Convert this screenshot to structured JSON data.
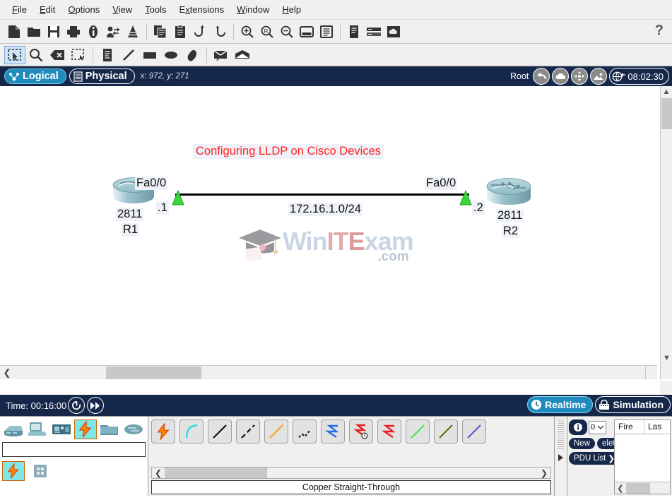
{
  "menubar": {
    "items": [
      {
        "label": "File",
        "accel": "F"
      },
      {
        "label": "Edit",
        "accel": "E"
      },
      {
        "label": "Options",
        "accel": "O"
      },
      {
        "label": "View",
        "accel": "V"
      },
      {
        "label": "Tools",
        "accel": "T"
      },
      {
        "label": "Extensions",
        "accel": "x"
      },
      {
        "label": "Window",
        "accel": "W"
      },
      {
        "label": "Help",
        "accel": "H"
      }
    ]
  },
  "toolbar": {
    "help_label": "?",
    "items": [
      {
        "name": "new-file-icon",
        "title": "New"
      },
      {
        "name": "open-folder-icon",
        "title": "Open"
      },
      {
        "name": "save-icon",
        "title": "Save"
      },
      {
        "name": "print-icon",
        "title": "Print"
      },
      {
        "name": "activity-wizard-icon",
        "title": "Activity Wizard"
      },
      {
        "name": "network-info-icon",
        "title": "Network Information"
      },
      {
        "name": "custom-devices-icon",
        "title": "Custom Devices"
      },
      {
        "name": "copy-icon",
        "title": "Copy"
      },
      {
        "name": "paste-icon",
        "title": "Paste"
      },
      {
        "name": "undo-icon",
        "title": "Undo"
      },
      {
        "name": "redo-icon",
        "title": "Redo"
      },
      {
        "name": "zoom-in-icon",
        "title": "Zoom In"
      },
      {
        "name": "zoom-reset-icon",
        "title": "Zoom Reset"
      },
      {
        "name": "zoom-out-icon",
        "title": "Zoom Out"
      },
      {
        "name": "palette-icon",
        "title": "Drawing Palette"
      },
      {
        "name": "custom-devices-dialog-icon",
        "title": "Custom Devices Dialog"
      },
      {
        "name": "viewport-icon",
        "title": "Viewport"
      },
      {
        "name": "device-rack-icon",
        "title": "Device Rack"
      },
      {
        "name": "cloud-registration-icon",
        "title": "Cloud"
      }
    ]
  },
  "toolbar2": {
    "items": [
      {
        "name": "select-tool-icon",
        "title": "Select",
        "selected": true
      },
      {
        "name": "inspect-tool-icon",
        "title": "Inspect"
      },
      {
        "name": "delete-tool-icon",
        "title": "Delete"
      },
      {
        "name": "resize-shape-tool-icon",
        "title": "Resize Shape"
      },
      {
        "name": "place-note-tool-icon",
        "title": "Place Note"
      },
      {
        "name": "draw-line-tool-icon",
        "title": "Draw Line"
      },
      {
        "name": "draw-rectangle-tool-icon",
        "title": "Draw Rectangle"
      },
      {
        "name": "draw-ellipse-tool-icon",
        "title": "Draw Ellipse"
      },
      {
        "name": "draw-freeform-tool-icon",
        "title": "Draw Freeform"
      },
      {
        "name": "add-simple-pdu-icon",
        "title": "Add Simple PDU"
      },
      {
        "name": "add-complex-pdu-icon",
        "title": "Add Complex PDU"
      }
    ]
  },
  "viewbar": {
    "logical_label": "Logical",
    "physical_label": "Physical",
    "coordinates": "x: 972, y: 271",
    "root_label": "Root",
    "clock": "08:02:30",
    "buttons": [
      {
        "name": "back-navigation-button",
        "title": "Back"
      },
      {
        "name": "set-tiled-background-button",
        "title": "New Cluster"
      },
      {
        "name": "move-object-button",
        "title": "Move Object"
      },
      {
        "name": "set-background-image-button",
        "title": "Set Tiled Background"
      }
    ]
  },
  "canvas": {
    "title": "Configuring LLDP on Cisco Devices",
    "devices": [
      {
        "id": "r1",
        "model": "2811",
        "hostname": "R1",
        "interface": "Fa0/0",
        "ip_suffix": ".1"
      },
      {
        "id": "r2",
        "model": "2811",
        "hostname": "R2",
        "interface": "Fa0/0",
        "ip_suffix": ".2"
      }
    ],
    "link_label": "172.16.1.0/24",
    "watermark": {
      "part1": "Win",
      "part2": "IT",
      "part3": "E",
      "part4": "xam",
      "domain": ".com"
    }
  },
  "timebar": {
    "time_label": "Time: 00:16:00",
    "power_cycle_title": "Power Cycle Devices",
    "fast_forward_title": "Fast Forward Time",
    "realtime_label": "Realtime",
    "simulation_label": "Simulation"
  },
  "device_panel": {
    "categories": [
      {
        "name": "network-devices-icon",
        "title": "Network Devices"
      },
      {
        "name": "end-devices-icon",
        "title": "End Devices"
      },
      {
        "name": "components-icon",
        "title": "Components"
      },
      {
        "name": "connections-icon",
        "title": "Connections",
        "selected": true
      },
      {
        "name": "miscellaneous-icon",
        "title": "Miscellaneous"
      },
      {
        "name": "multiuser-connection-icon",
        "title": "Multiuser Connection"
      }
    ],
    "search_placeholder": "",
    "search_value": "",
    "subcategories": [
      {
        "name": "connections-subcategory-icon",
        "title": "Connections",
        "selected": true
      },
      {
        "name": "all-devices-grid-icon",
        "title": "All Devices"
      }
    ]
  },
  "connection_panel": {
    "status_label": "Copper Straight-Through",
    "items": [
      {
        "name": "automatic-connection-icon",
        "title": "Automatically Choose Connection Type"
      },
      {
        "name": "console-cable-icon",
        "title": "Console"
      },
      {
        "name": "copper-straight-through-icon",
        "title": "Copper Straight-Through"
      },
      {
        "name": "copper-crossover-icon",
        "title": "Copper Cross-Over"
      },
      {
        "name": "fiber-cable-icon",
        "title": "Fiber"
      },
      {
        "name": "phone-cable-icon",
        "title": "Phone"
      },
      {
        "name": "coaxial-cable-icon",
        "title": "Coaxial"
      },
      {
        "name": "serial-dce-icon",
        "title": "Serial DCE"
      },
      {
        "name": "serial-dte-icon",
        "title": "Serial DTE"
      },
      {
        "name": "octal-cable-icon",
        "title": "Octal"
      },
      {
        "name": "usb-cable-icon",
        "title": "USB"
      },
      {
        "name": "iot-custom-cable-icon",
        "title": "IoT Custom Cable"
      }
    ]
  },
  "right_panel": {
    "scenario_value": "0",
    "new_label": "New",
    "delete_label": "elet",
    "toggle_pdu_list_label": "PDU List",
    "table_headers": [
      "Fire",
      "Las"
    ]
  }
}
